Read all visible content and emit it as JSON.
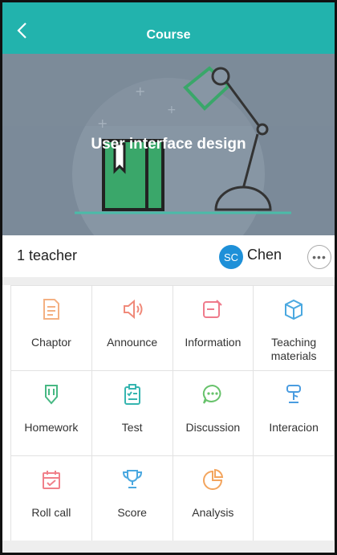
{
  "header": {
    "title": "Course",
    "back_icon": "chevron-left-icon",
    "bg_color": "#22b3ad"
  },
  "banner": {
    "title": "User interface design"
  },
  "teacher_bar": {
    "count_label": "1 teacher",
    "avatar_initials": "SC",
    "teacher_name": "Chen",
    "more_icon": "more-dots-icon"
  },
  "grid": {
    "items": [
      {
        "label": "Chaptor",
        "icon": "document-icon",
        "color": "#f4b183"
      },
      {
        "label": "Announce",
        "icon": "speaker-icon",
        "color": "#f08a7a"
      },
      {
        "label": "Information",
        "icon": "notes-icon",
        "color": "#ef7b8c"
      },
      {
        "label": "Teaching materials",
        "icon": "box-icon",
        "color": "#4aa8e0"
      },
      {
        "label": "Homework",
        "icon": "pen-icon",
        "color": "#47b883"
      },
      {
        "label": "Test",
        "icon": "clipboard-icon",
        "color": "#36b5b0"
      },
      {
        "label": "Discussion",
        "icon": "chat-icon",
        "color": "#67c26b"
      },
      {
        "label": "Interacion",
        "icon": "lamp-icon",
        "color": "#4a9ce0"
      },
      {
        "label": "Roll call",
        "icon": "calendar-icon",
        "color": "#f0808a"
      },
      {
        "label": "Score",
        "icon": "trophy-icon",
        "color": "#4aa8e0"
      },
      {
        "label": "Analysis",
        "icon": "pie-chart-icon",
        "color": "#f3a55e"
      }
    ]
  }
}
